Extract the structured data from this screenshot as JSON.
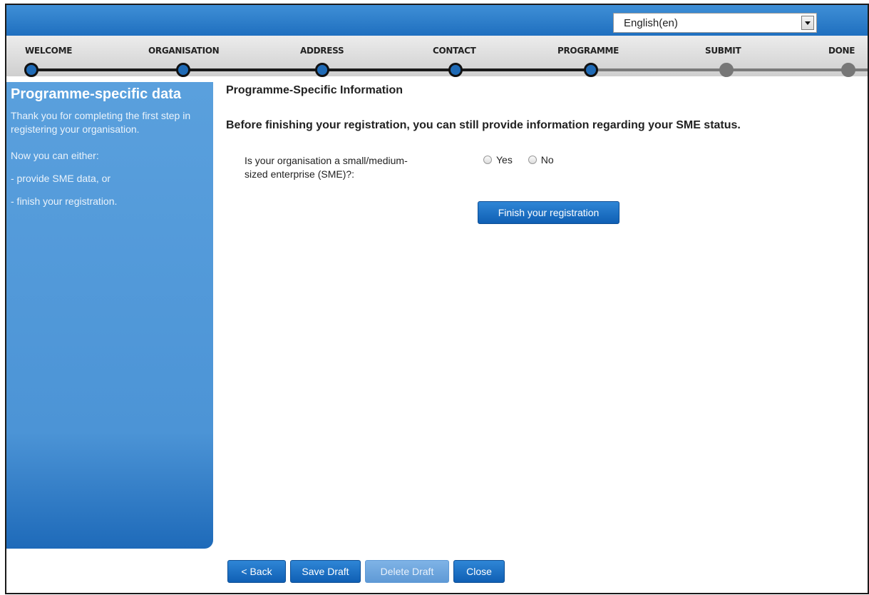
{
  "language": {
    "selected": "English(en)"
  },
  "steps": [
    {
      "label": "WELCOME",
      "status": "done"
    },
    {
      "label": "ORGANISATION",
      "status": "done"
    },
    {
      "label": "ADDRESS",
      "status": "done"
    },
    {
      "label": "CONTACT",
      "status": "done"
    },
    {
      "label": "PROGRAMME",
      "status": "done"
    },
    {
      "label": "SUBMIT",
      "status": "todo"
    },
    {
      "label": "DONE",
      "status": "todo"
    }
  ],
  "sidebar": {
    "title": "Programme-specific data",
    "para1": "Thank you for completing the first step in registering your organisation.",
    "para2": "Now you can either:",
    "para3": "- provide SME data, or",
    "para4": "- finish your registration."
  },
  "main": {
    "title": "Programme-Specific Information",
    "subtitle": "Before finishing your registration, you can still provide information regarding your SME status.",
    "question": "Is your organisation a small/medium-sized enterprise (SME)?:",
    "options": [
      "Yes",
      "No"
    ],
    "finish_label": "Finish your registration"
  },
  "footer": {
    "back_label": "< Back",
    "save_label": "Save Draft",
    "delete_label": "Delete Draft",
    "close_label": "Close"
  },
  "colors": {
    "accent": "#1f6ab5",
    "panel": "#4c94d6",
    "step_todo": "#777777"
  }
}
